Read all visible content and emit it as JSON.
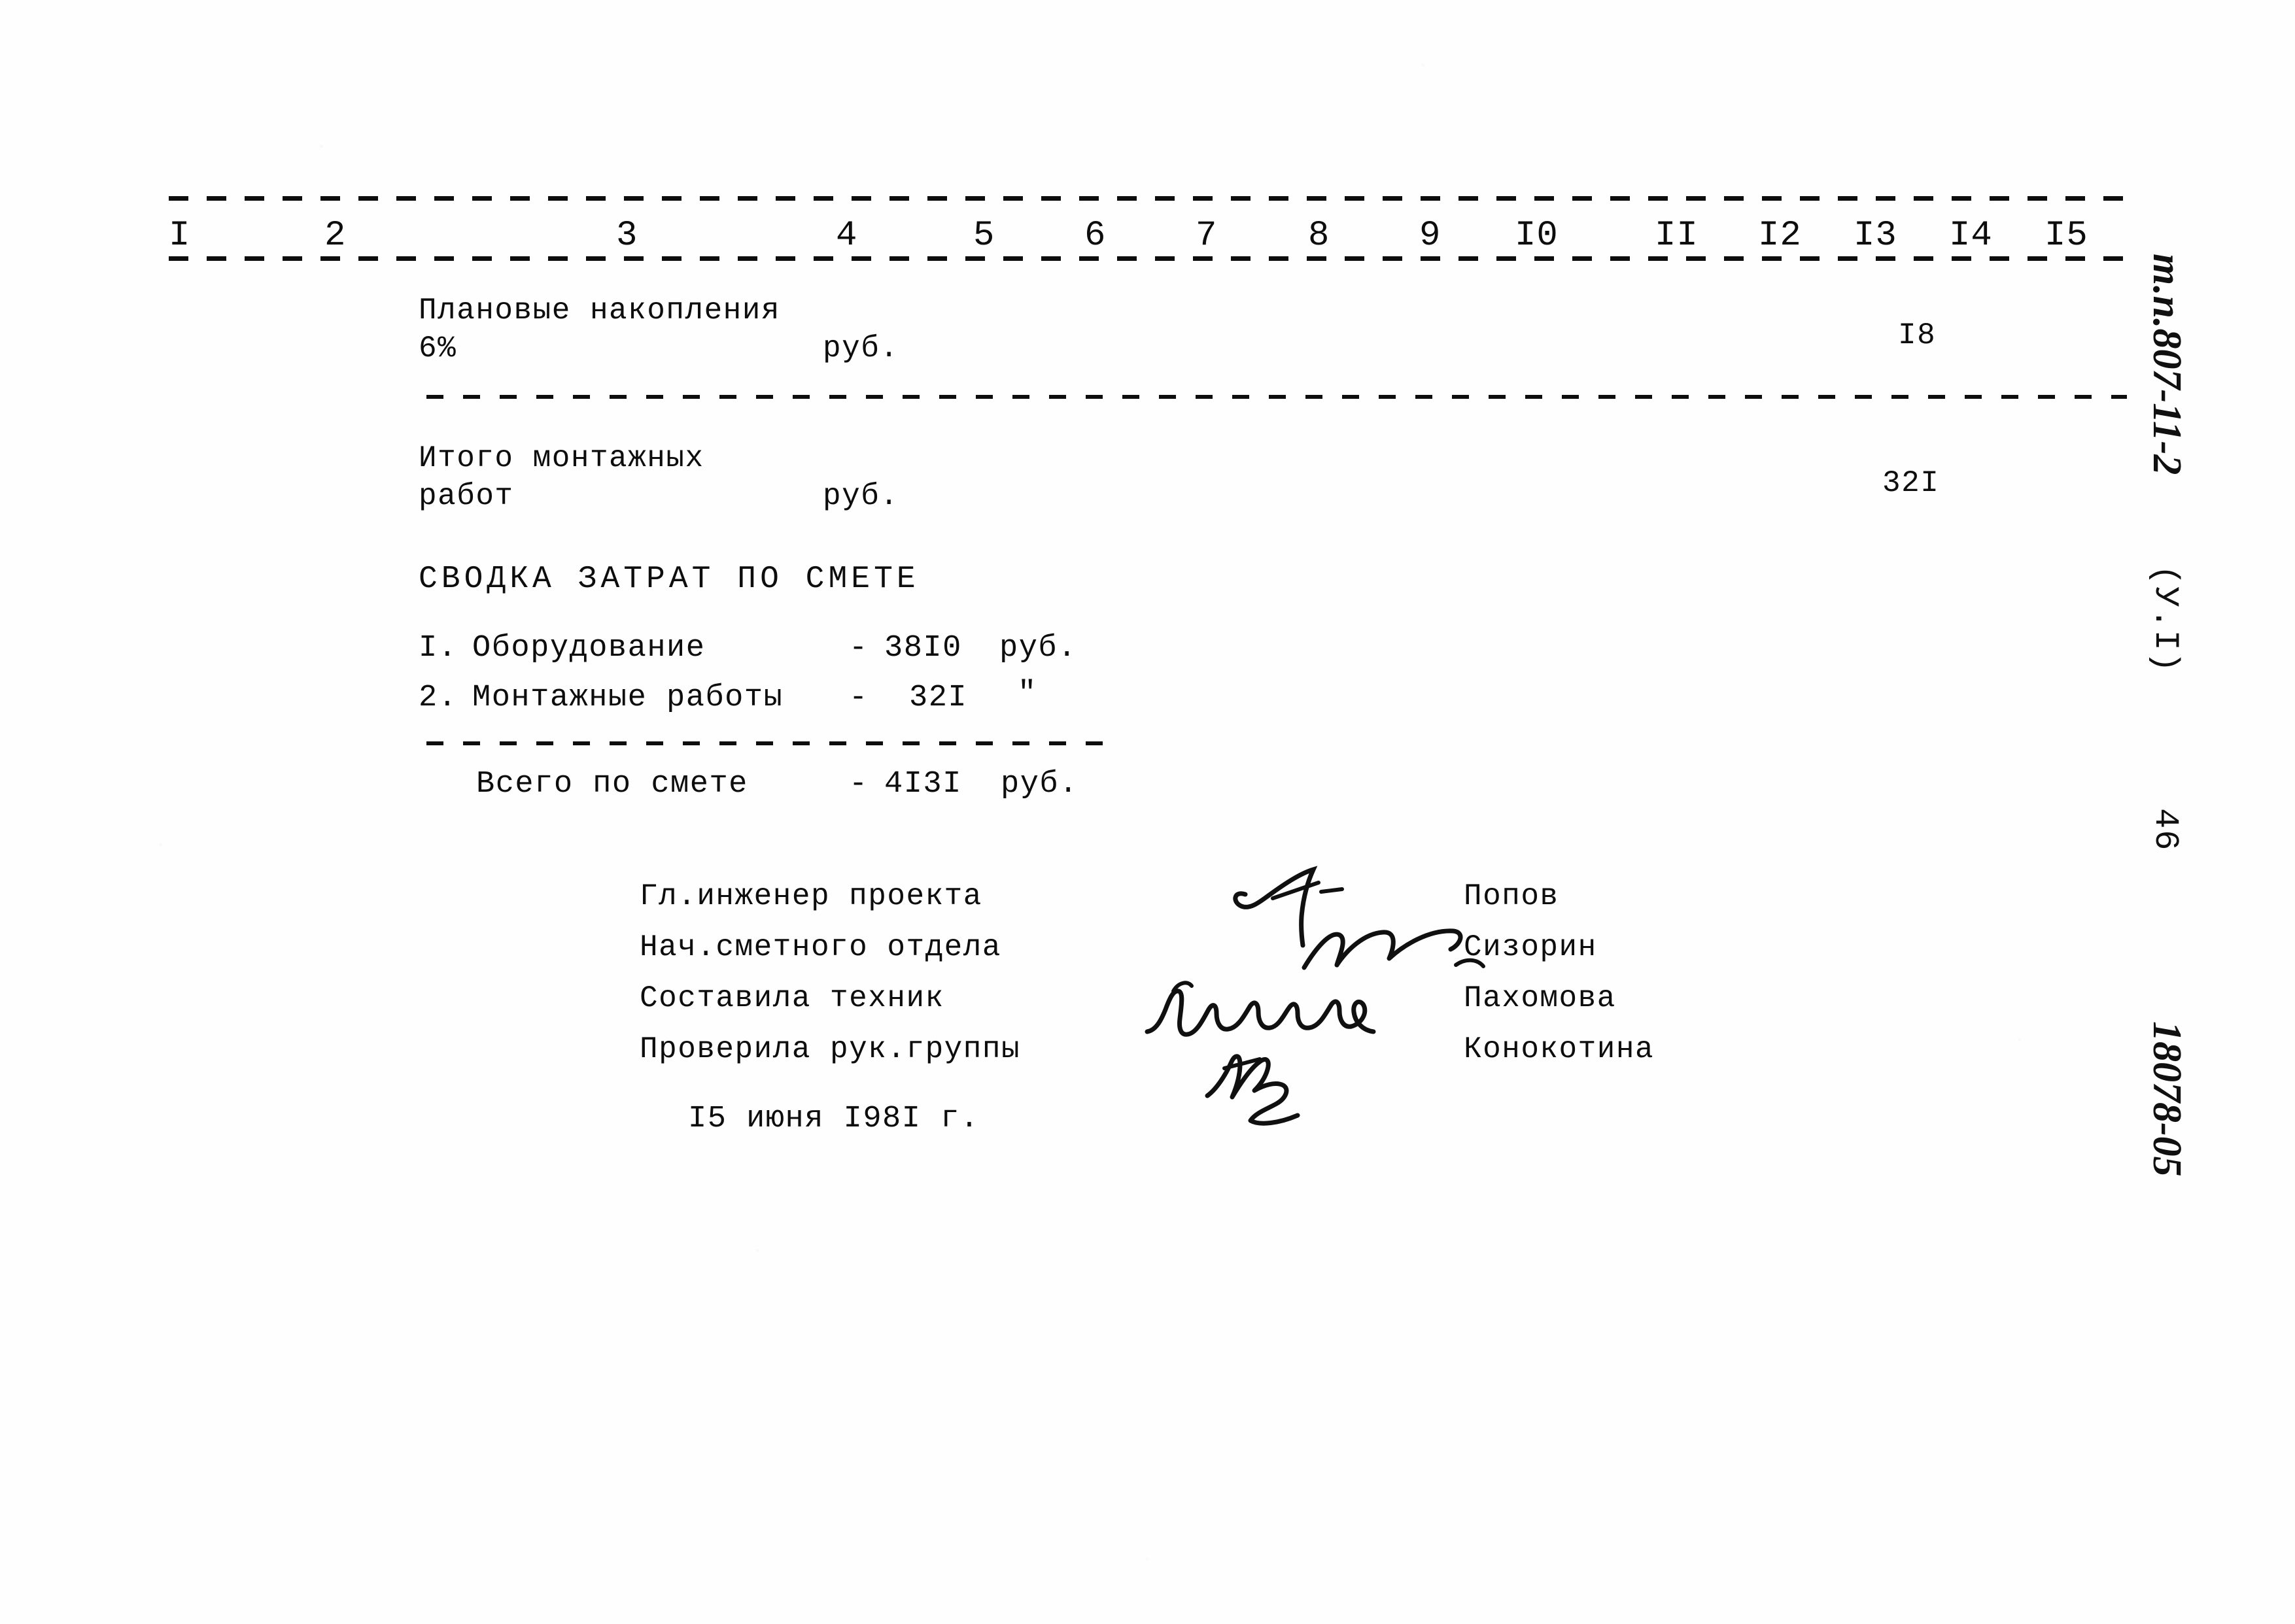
{
  "document": {
    "kind": "soviet-typewritten-estimate-sheet",
    "column_numbers": [
      "I",
      "2",
      "3",
      "4",
      "5",
      "6",
      "7",
      "8",
      "9",
      "I0",
      "II",
      "I2",
      "I3",
      "I4",
      "I5"
    ]
  },
  "rows": [
    {
      "label_line1": "Плановые накопления",
      "label_line2": "6%",
      "unit": "руб.",
      "value": "I8"
    },
    {
      "label_line1": "Итого монтажных",
      "label_line2": "работ",
      "unit": "руб.",
      "value": "32I"
    }
  ],
  "summary": {
    "heading": "СВОДКА ЗАТРАТ ПО СМЕТЕ",
    "items": [
      {
        "no": "I.",
        "name": "Оборудование",
        "dash": "-",
        "amount": "38I0",
        "unit": "руб."
      },
      {
        "no": "2.",
        "name": "Монтажные работы",
        "dash": "-",
        "amount": "32I",
        "unit": "\""
      }
    ],
    "total": {
      "label": "Всего по смете",
      "dash": "-",
      "amount": "4I3I",
      "unit": "руб."
    }
  },
  "signatures": {
    "roles": [
      "Гл.инженер проекта",
      "Нач.сметного отдела",
      "Составила техник",
      "Проверила рук.группы"
    ],
    "names": [
      "Попов",
      "Сизорин",
      "Пахомова",
      "Конокотина"
    ]
  },
  "date_line": "I5 июня I98I г.",
  "margin_notes": {
    "project_code": "т.п.807-11-2",
    "section": "(У.I)",
    "page_number": "46",
    "archive_code": "18078-05"
  }
}
